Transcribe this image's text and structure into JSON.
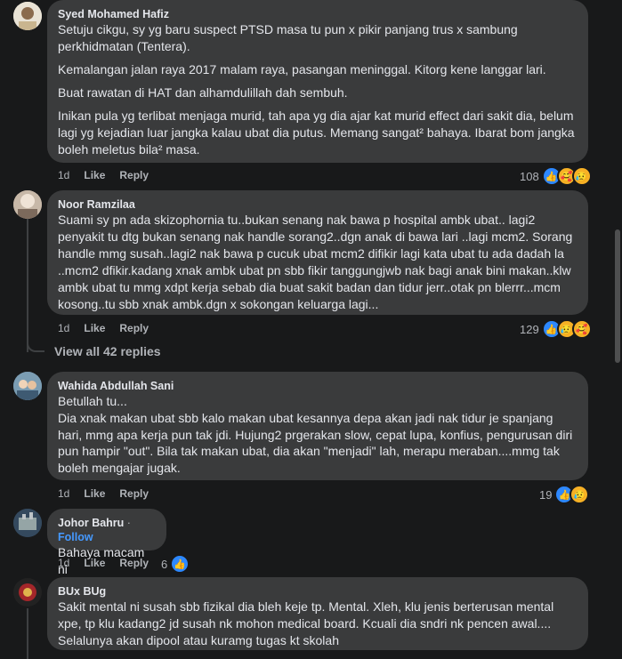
{
  "comments": [
    {
      "name": "Syed Mohamed Hafiz",
      "paragraphs": [
        "Setuju cikgu, sy yg baru suspect PTSD masa tu pun x pikir panjang trus x sambung perkhidmatan (Tentera).",
        "Kemalangan jalan raya 2017 malam raya, pasangan meninggal. Kitorg kene langgar lari.",
        "Buat rawatan di HAT dan alhamdulillah dah sembuh.",
        "Inikan pula yg terlibat menjaga murid, tah apa yg dia ajar kat murid effect dari sakit dia, belum lagi yg kejadian luar jangka kalau ubat dia putus. Memang sangat² bahaya. Ibarat bom jangka boleh meletus bila² masa."
      ],
      "time": "1d",
      "like": "Like",
      "reply": "Reply",
      "reaction_count": "108"
    },
    {
      "name": "Noor Ramzilaa",
      "paragraphs": [
        "Suami sy pn ada skizophornia tu..bukan senang nak bawa p hospital ambk ubat.. lagi2 penyakit tu dtg bukan senang nak handle sorang2..dgn anak di bawa lari ..lagi mcm2. Sorang handle mmg susah..lagi2 nak bawa p cucuk ubat mcm2 difikir lagi kata ubat tu ada dadah la ..mcm2 dfikir.kadang xnak ambk ubat pn sbb fikir tanggungjwb nak bagi anak bini makan..klw ambk ubat tu mmg xdpt kerja sebab dia buat sakit badan dan tidur jerr..otak pn blerrr...mcm kosong..tu sbb xnak ambk.dgn x sokongan keluarga lagi..."
      ],
      "time": "1d",
      "like": "Like",
      "reply": "Reply",
      "reaction_count": "129"
    },
    {
      "name": "Wahida Abdullah Sani",
      "paragraphs": [
        "Betullah tu...",
        "Dia xnak makan ubat sbb kalo makan ubat kesannya depa akan jadi nak tidur je spanjang hari, mmg apa kerja pun tak jdi. Hujung2 prgerakan slow, cepat lupa, konfius, pengurusan diri pun hampir \"out\". Bila tak makan ubat, dia akan \"menjadi\" lah, merapu meraban....mmg tak boleh mengajar jugak."
      ],
      "time": "1d",
      "like": "Like",
      "reply": "Reply",
      "reaction_count": "19"
    },
    {
      "name": "Johor Bahru",
      "follow": "Follow",
      "separator": " · ",
      "paragraphs": [
        "Bahaya macam ni"
      ],
      "time": "1d",
      "like": "Like",
      "reply": "Reply",
      "reaction_count": "6"
    },
    {
      "name": "BUx BUg",
      "paragraphs": [
        "Sakit mental ni susah sbb fizikal dia bleh keje tp. Mental. Xleh, klu jenis berterusan mental xpe, tp klu kadang2 jd susah nk mohon medical board. Kcuali dia sndri nk pencen awal.... Selalunya akan dipool atau kuramg tugas kt skolah"
      ]
    }
  ],
  "view_replies": "View all 42 replies",
  "colors": {
    "background": "#18191a",
    "bubble": "#3a3b3c",
    "like_blue": "#2d88ff",
    "follow_blue": "#4599ff"
  },
  "icons": {
    "like": "like-reaction-icon",
    "care": "care-reaction-icon",
    "sad": "sad-reaction-icon"
  }
}
